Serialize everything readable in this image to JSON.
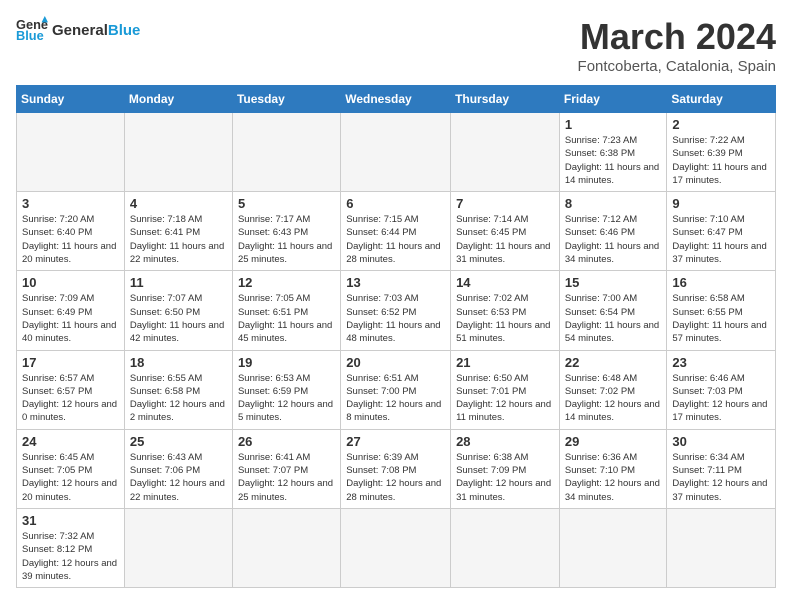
{
  "header": {
    "logo_general": "General",
    "logo_blue": "Blue",
    "month_title": "March 2024",
    "location": "Fontcoberta, Catalonia, Spain"
  },
  "weekdays": [
    "Sunday",
    "Monday",
    "Tuesday",
    "Wednesday",
    "Thursday",
    "Friday",
    "Saturday"
  ],
  "weeks": [
    [
      {
        "day": "",
        "info": ""
      },
      {
        "day": "",
        "info": ""
      },
      {
        "day": "",
        "info": ""
      },
      {
        "day": "",
        "info": ""
      },
      {
        "day": "",
        "info": ""
      },
      {
        "day": "1",
        "info": "Sunrise: 7:23 AM\nSunset: 6:38 PM\nDaylight: 11 hours and 14 minutes."
      },
      {
        "day": "2",
        "info": "Sunrise: 7:22 AM\nSunset: 6:39 PM\nDaylight: 11 hours and 17 minutes."
      }
    ],
    [
      {
        "day": "3",
        "info": "Sunrise: 7:20 AM\nSunset: 6:40 PM\nDaylight: 11 hours and 20 minutes."
      },
      {
        "day": "4",
        "info": "Sunrise: 7:18 AM\nSunset: 6:41 PM\nDaylight: 11 hours and 22 minutes."
      },
      {
        "day": "5",
        "info": "Sunrise: 7:17 AM\nSunset: 6:43 PM\nDaylight: 11 hours and 25 minutes."
      },
      {
        "day": "6",
        "info": "Sunrise: 7:15 AM\nSunset: 6:44 PM\nDaylight: 11 hours and 28 minutes."
      },
      {
        "day": "7",
        "info": "Sunrise: 7:14 AM\nSunset: 6:45 PM\nDaylight: 11 hours and 31 minutes."
      },
      {
        "day": "8",
        "info": "Sunrise: 7:12 AM\nSunset: 6:46 PM\nDaylight: 11 hours and 34 minutes."
      },
      {
        "day": "9",
        "info": "Sunrise: 7:10 AM\nSunset: 6:47 PM\nDaylight: 11 hours and 37 minutes."
      }
    ],
    [
      {
        "day": "10",
        "info": "Sunrise: 7:09 AM\nSunset: 6:49 PM\nDaylight: 11 hours and 40 minutes."
      },
      {
        "day": "11",
        "info": "Sunrise: 7:07 AM\nSunset: 6:50 PM\nDaylight: 11 hours and 42 minutes."
      },
      {
        "day": "12",
        "info": "Sunrise: 7:05 AM\nSunset: 6:51 PM\nDaylight: 11 hours and 45 minutes."
      },
      {
        "day": "13",
        "info": "Sunrise: 7:03 AM\nSunset: 6:52 PM\nDaylight: 11 hours and 48 minutes."
      },
      {
        "day": "14",
        "info": "Sunrise: 7:02 AM\nSunset: 6:53 PM\nDaylight: 11 hours and 51 minutes."
      },
      {
        "day": "15",
        "info": "Sunrise: 7:00 AM\nSunset: 6:54 PM\nDaylight: 11 hours and 54 minutes."
      },
      {
        "day": "16",
        "info": "Sunrise: 6:58 AM\nSunset: 6:55 PM\nDaylight: 11 hours and 57 minutes."
      }
    ],
    [
      {
        "day": "17",
        "info": "Sunrise: 6:57 AM\nSunset: 6:57 PM\nDaylight: 12 hours and 0 minutes."
      },
      {
        "day": "18",
        "info": "Sunrise: 6:55 AM\nSunset: 6:58 PM\nDaylight: 12 hours and 2 minutes."
      },
      {
        "day": "19",
        "info": "Sunrise: 6:53 AM\nSunset: 6:59 PM\nDaylight: 12 hours and 5 minutes."
      },
      {
        "day": "20",
        "info": "Sunrise: 6:51 AM\nSunset: 7:00 PM\nDaylight: 12 hours and 8 minutes."
      },
      {
        "day": "21",
        "info": "Sunrise: 6:50 AM\nSunset: 7:01 PM\nDaylight: 12 hours and 11 minutes."
      },
      {
        "day": "22",
        "info": "Sunrise: 6:48 AM\nSunset: 7:02 PM\nDaylight: 12 hours and 14 minutes."
      },
      {
        "day": "23",
        "info": "Sunrise: 6:46 AM\nSunset: 7:03 PM\nDaylight: 12 hours and 17 minutes."
      }
    ],
    [
      {
        "day": "24",
        "info": "Sunrise: 6:45 AM\nSunset: 7:05 PM\nDaylight: 12 hours and 20 minutes."
      },
      {
        "day": "25",
        "info": "Sunrise: 6:43 AM\nSunset: 7:06 PM\nDaylight: 12 hours and 22 minutes."
      },
      {
        "day": "26",
        "info": "Sunrise: 6:41 AM\nSunset: 7:07 PM\nDaylight: 12 hours and 25 minutes."
      },
      {
        "day": "27",
        "info": "Sunrise: 6:39 AM\nSunset: 7:08 PM\nDaylight: 12 hours and 28 minutes."
      },
      {
        "day": "28",
        "info": "Sunrise: 6:38 AM\nSunset: 7:09 PM\nDaylight: 12 hours and 31 minutes."
      },
      {
        "day": "29",
        "info": "Sunrise: 6:36 AM\nSunset: 7:10 PM\nDaylight: 12 hours and 34 minutes."
      },
      {
        "day": "30",
        "info": "Sunrise: 6:34 AM\nSunset: 7:11 PM\nDaylight: 12 hours and 37 minutes."
      }
    ],
    [
      {
        "day": "31",
        "info": "Sunrise: 7:32 AM\nSunset: 8:12 PM\nDaylight: 12 hours and 39 minutes."
      },
      {
        "day": "",
        "info": ""
      },
      {
        "day": "",
        "info": ""
      },
      {
        "day": "",
        "info": ""
      },
      {
        "day": "",
        "info": ""
      },
      {
        "day": "",
        "info": ""
      },
      {
        "day": "",
        "info": ""
      }
    ]
  ]
}
